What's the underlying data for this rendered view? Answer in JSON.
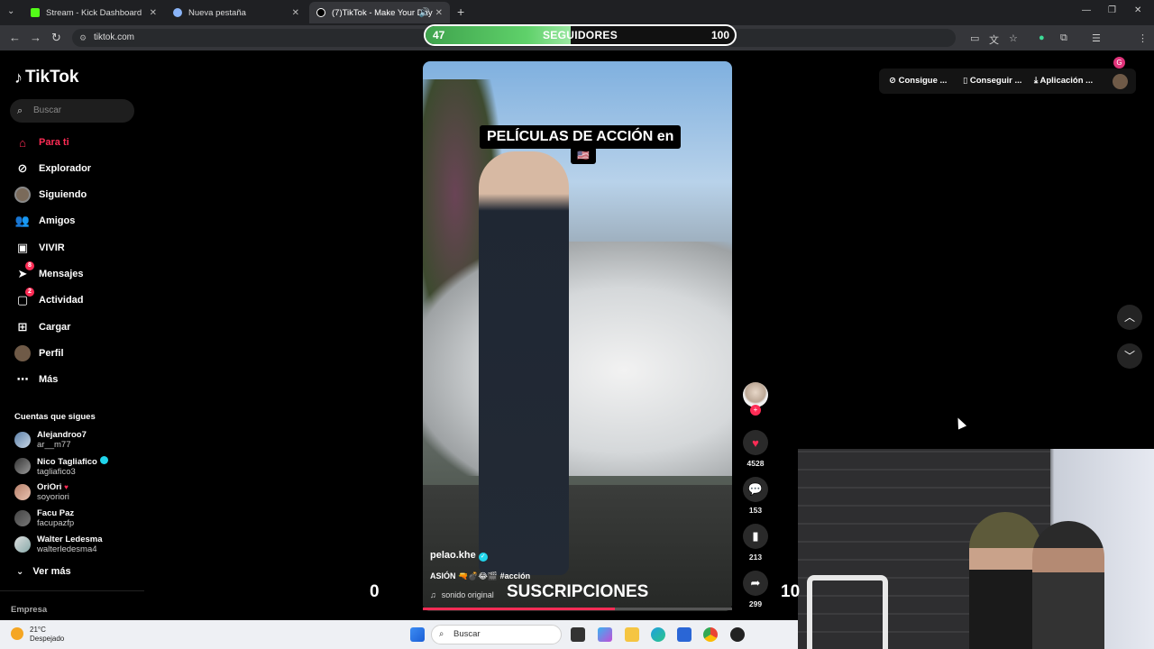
{
  "browser": {
    "tabs": [
      {
        "label": "Stream - Kick Dashboard",
        "color": "#53fc18"
      },
      {
        "label": "Nueva pestaña",
        "color": "#8ab4f8"
      },
      {
        "label": "(7)TikTok - Make Your Day",
        "color": "#ffffff"
      }
    ],
    "url": "tiktok.com",
    "new_tab": "+"
  },
  "followers_bar": {
    "current": "47",
    "label": "SEGUIDORES",
    "goal": "100",
    "progress": 0.47,
    "color": "#5fd16a"
  },
  "sidebar": {
    "logo": "TikTok",
    "search_placeholder": "Buscar",
    "nav": [
      {
        "label": "Para ti",
        "icon": "home-icon"
      },
      {
        "label": "Explorador",
        "icon": "compass-icon"
      },
      {
        "label": "Siguiendo",
        "icon": "following-icon"
      },
      {
        "label": "Amigos",
        "icon": "friends-icon"
      },
      {
        "label": "VIVIR",
        "icon": "live-icon"
      },
      {
        "label": "Mensajes",
        "icon": "messages-icon",
        "badge": "8"
      },
      {
        "label": "Actividad",
        "icon": "activity-icon",
        "badge": "2"
      },
      {
        "label": "Cargar",
        "icon": "upload-icon"
      },
      {
        "label": "Perfil",
        "icon": "profile-icon"
      },
      {
        "label": "Más",
        "icon": "more-icon"
      }
    ],
    "following_title": "Cuentas que sigues",
    "accounts": [
      {
        "name": "Alejandroo7",
        "handle": "ar__m77"
      },
      {
        "name": "Nico Tagliafico",
        "handle": "tagliafico3"
      },
      {
        "name": "OriOri",
        "handle": "soyoriori"
      },
      {
        "name": "Facu Paz",
        "handle": "facupazfp"
      },
      {
        "name": "Walter Ledesma",
        "handle": "walterledesma4"
      }
    ],
    "see_more": "Ver más",
    "company": "Empresa"
  },
  "top_actions": {
    "get_coins": "Consigue ...",
    "get_app": "Conseguir ...",
    "app": "Aplicación ..."
  },
  "video": {
    "overlay_title": "PELÍCULAS DE ACCIÓN en",
    "flag": "🇺🇸",
    "username": "pelao.khe",
    "tags": "ASIÓN 🔫💣😂🎬 #acción",
    "sound": "sonido original",
    "progress": 0.62,
    "likes": "4528",
    "comments": "153",
    "saves": "213",
    "shares": "299"
  },
  "stream": {
    "subs_label": "SUSCRIPCIONES",
    "subs_current": "0",
    "subs_goal": "10"
  },
  "taskbar": {
    "temp": "21°C",
    "weather": "Despejado",
    "search_placeholder": "Buscar"
  }
}
